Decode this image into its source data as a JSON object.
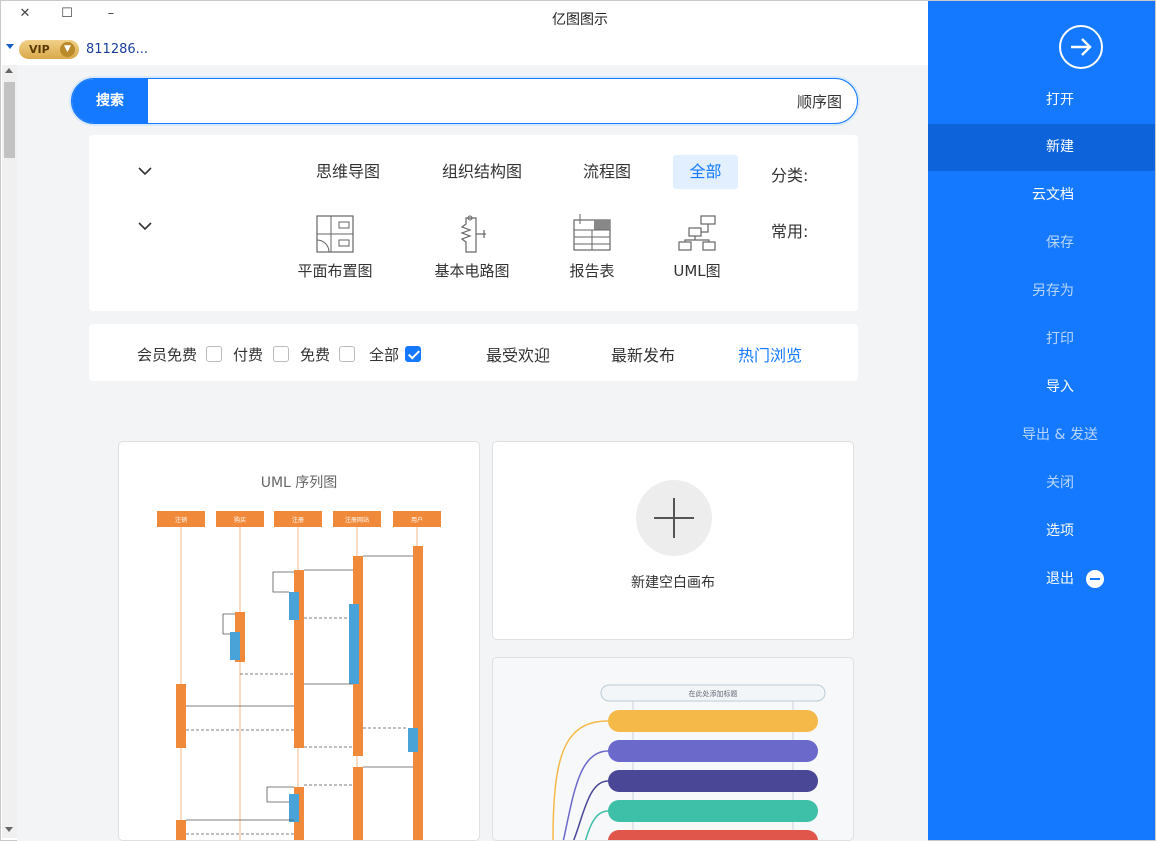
{
  "window": {
    "title": "亿图图示",
    "close_glyph": "✕",
    "maximize_glyph": "☐",
    "minimize_glyph": "–"
  },
  "account": {
    "vip_label": "VIP",
    "user": "811286..."
  },
  "search": {
    "button_label": "搜索",
    "value": "顺序图"
  },
  "filters": {
    "category_label": "分类:",
    "categories": [
      "全部",
      "流程图",
      "组织结构图",
      "思维导图"
    ],
    "active_category": "全部",
    "common_label": "常用:",
    "common_items": [
      {
        "label": "UML图",
        "icon": "uml-diagram-icon"
      },
      {
        "label": "报告表",
        "icon": "report-table-icon"
      },
      {
        "label": "基本电路图",
        "icon": "circuit-diagram-icon"
      },
      {
        "label": "平面布置图",
        "icon": "floor-plan-icon"
      }
    ]
  },
  "sort": {
    "options": [
      "热门浏览",
      "最新发布",
      "最受欢迎"
    ],
    "active": "热门浏览",
    "price_filters": [
      {
        "label": "全部",
        "checked": true
      },
      {
        "label": "免费",
        "checked": false
      },
      {
        "label": "付费",
        "checked": false
      },
      {
        "label": "会员免费",
        "checked": false
      }
    ]
  },
  "templates": {
    "uml_title": "UML 序列图",
    "uml_lifelines": [
      "用户",
      "注册网站",
      "注册",
      "购买",
      "注销"
    ],
    "new_blank_label": "新建空白画布",
    "mind_map_title": "在此处添加标题"
  },
  "sidebar": {
    "items": [
      {
        "label": "打开",
        "dim": false
      },
      {
        "label": "新建",
        "dim": false
      },
      {
        "label": "云文档",
        "dim": false
      },
      {
        "label": "保存",
        "dim": true
      },
      {
        "label": "另存为",
        "dim": true
      },
      {
        "label": "打印",
        "dim": true
      },
      {
        "label": "导入",
        "dim": false
      },
      {
        "label": "导出 & 发送",
        "dim": true
      },
      {
        "label": "关闭",
        "dim": true
      },
      {
        "label": "选项",
        "dim": false
      },
      {
        "label": "退出",
        "dim": false
      }
    ],
    "selected": "新建"
  },
  "colors": {
    "accent": "#1479ff",
    "sidebar": "#1479ff",
    "sidebar_selected": "#0d63d9",
    "uml_orange": "#f08a3a",
    "uml_blue": "#4aa3d8"
  }
}
